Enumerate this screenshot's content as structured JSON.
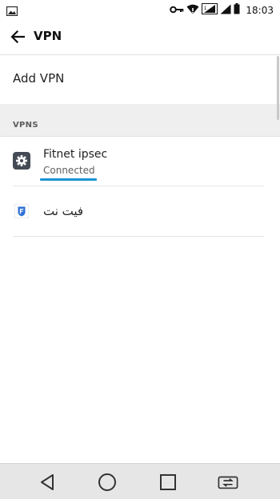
{
  "status_bar": {
    "time": "18:03"
  },
  "toolbar": {
    "title": "VPN"
  },
  "add_vpn": {
    "label": "Add VPN"
  },
  "section": {
    "label": "VPNS"
  },
  "vpns": [
    {
      "name": "Fitnet ipsec",
      "status": "Connected",
      "icon": "gear-icon"
    },
    {
      "name": "فيت نت",
      "icon": "fitnet-app-icon"
    }
  ],
  "nav": {
    "buttons": [
      "back-triangle",
      "home-circle",
      "recents-square",
      "switch-sim"
    ]
  },
  "colors": {
    "accent": "#1a94d2",
    "section_bg": "#efefef",
    "navbar_bg": "#e6e6e6"
  }
}
